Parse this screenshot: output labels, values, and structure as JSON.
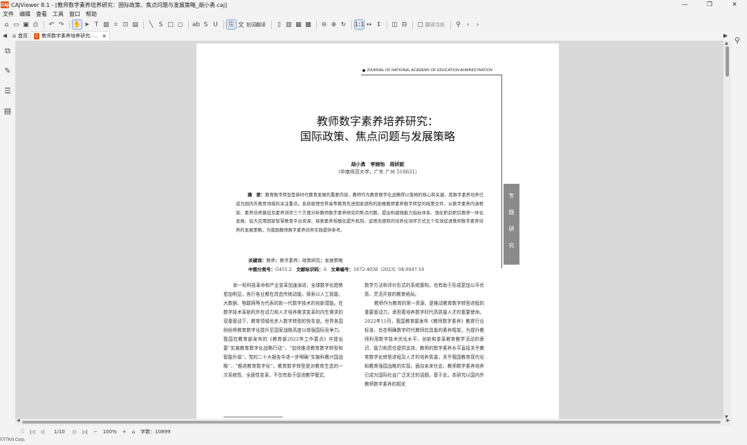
{
  "window": {
    "app_logo": "CAJ",
    "title": "CAJViewer 8.1 - [教师数字素养培养研究：国际政策、焦点问题与发展策略_胡小勇.caj]",
    "controls": [
      "—",
      "❐",
      "✕"
    ]
  },
  "menu": [
    "文件",
    "编辑",
    "查看",
    "工具",
    "窗口",
    "帮助"
  ],
  "toolbar": {
    "translate_label": "划词翻译",
    "translate_current_label": "翻译当前"
  },
  "tabs": [
    {
      "label": "首页"
    },
    {
      "label": "教师数字素养培养研究: ..."
    }
  ],
  "sidebar": {
    "icons": [
      "copy-icon",
      "edit-icon",
      "list-icon",
      "notes-icon"
    ]
  },
  "document": {
    "journal_header": "JOURNAL OF NATIONAL ACADEMY OF EDUCATION ADMINISTRATION",
    "title_line1": "教师数字素养培养研究：",
    "title_line2": "国际政策、焦点问题与发展策略",
    "authors": "胡小勇　李婉怡　周妍妮",
    "affiliation": "（华南师范大学，广东 广州 510631）",
    "topic_tab": [
      "专",
      "题",
      "研",
      "究"
    ],
    "abstract_label": "摘　要：",
    "abstract_text": "教育数字转型是新时代教育发展的重要内容，教师作为教育数字化战略得以落地的核心和关键，其数字素养培养已成为国内外教育领域的关注重点。系统梳理世界高等教育先进国家颁布的助推教师素养数字转型的政策文件，从数字素养内涵框架、素养培养路径及素养测评三个方面分析教师数字素养研究的焦点问题，提出构建微能力指标体系、强化职前职后教师一体化发展、加大应用国家智慧教育平台资源、探索素养规模化提升机制、运用无感知的培养化测评方式五个有效促进教师数字素养培养的发展策略，为我国教师数字素养培养实践提供参考。",
    "keywords_label": "关键词：",
    "keywords_text": "教师；数字素养；政策研究；发展策略",
    "class_label": "中图分类号：",
    "class_value": "G451.2",
    "doc_code_label": "文献标识码：",
    "doc_code_value": "A",
    "article_no_label": "文章编号：",
    "article_no_value": "1672-4038（2023）04-0047-10",
    "col_left": "新一轮科技革命和产业变革加速演进，全球数字化趋势愈加明显，各行各业都在改造传统动能，探索以人工智能、大数据、物联网等为代表的新一代数字技术的创新潜能。在数字技术革新的外在动力和人才培养需求变革的内生需求的双重驱动下，教育领域也步入数字转型的快车道。世界各国纷纷将教育数字化提升至国家战略高度以增强国际竞争力。我国在教育部发布的《教育部2022年工作要点》中提出要“实施教育数字化战略行动”，“加快推进教育数字转型和智能升级”。党的二十大报告中进一步明确“实施科教兴国战略”，“推进教育数字化”。教育数字转型是对教育生态的一次系统性、全面性变革，不仅有助于促进教学模式、",
    "col_right_1": "数学方法和评价形式的系统重构，也有助于形成更加公平优质、灵活开放的教育格局。",
    "col_right_2": "教师作为教育的第一资源，是推动教育数字转型进程的重要驱动力，承担着培养数字时代高质量人才的重要使命。2022年11月，我国教育部发布《教师数字素养》教育行业标准，旨在明确数字时代教师应具备的素养框架，为提升教师利用数字技术优化水平，创新和变革教育教学活动的意识、能力和责任提供支持。教师的数字素养水平直接关乎教育数字化转型进程及人才的培养质量，关乎我国教育现代化和教育强国战略的实现。面向未来社会，教师数字素养培养已成为国际社会广泛关注的话题。基于此，本研究以国内外教师数字素养的相关"
  },
  "status": {
    "page_indicator": "1/10",
    "zoom": "100%",
    "word_count_label": "字数：",
    "word_count": "10899"
  },
  "copyright": "©TTKN Corp."
}
